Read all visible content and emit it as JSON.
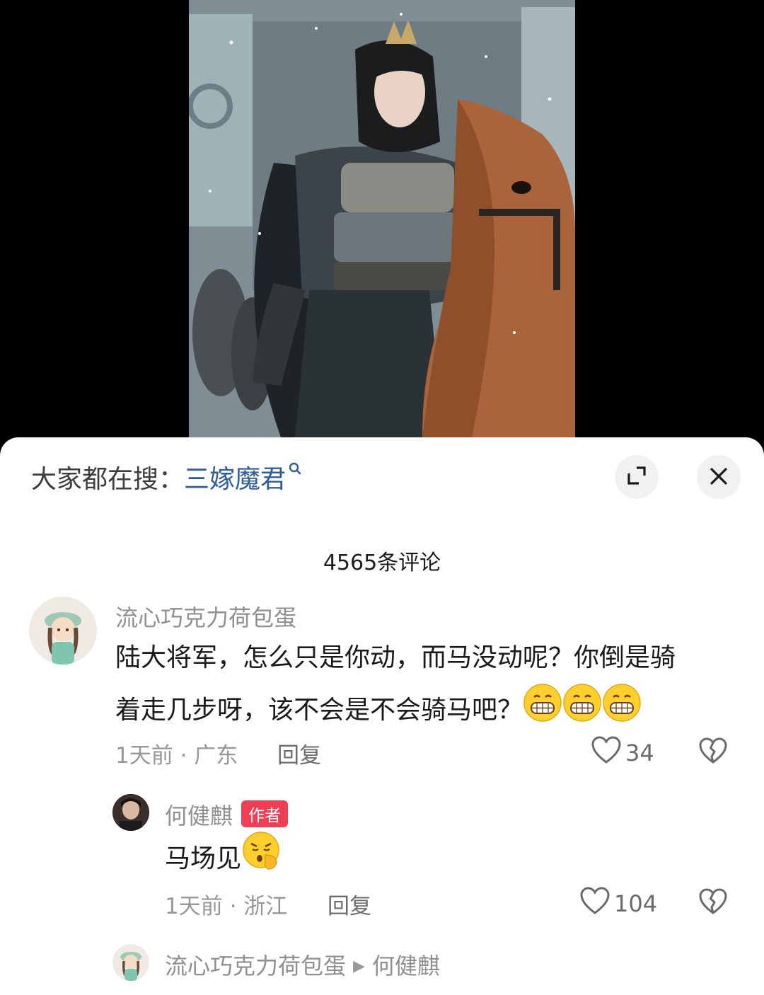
{
  "search": {
    "label": "大家都在搜：",
    "term": "三嫁魔君",
    "icon": "search-icon"
  },
  "header_icons": {
    "expand": "expand-icon",
    "close": "close-icon"
  },
  "comments_count": "4565条评论",
  "comments": [
    {
      "username": "流心巧克力荷包蛋",
      "text_line1": "陆大将军，怎么只是你动，而马没动呢？你倒是骑",
      "text_line2": "着走几步呀，该不会是不会骑马吧？",
      "emojis": [
        "grin-emoji",
        "grin-emoji",
        "grin-emoji"
      ],
      "time": "1天前 · 广东",
      "reply_label": "回复",
      "likes": "34"
    },
    {
      "username": "何健麒",
      "badge": "作者",
      "text": "马场见",
      "emoji": "shush-emoji",
      "time": "1天前 · 浙江",
      "reply_label": "回复",
      "likes": "104"
    },
    {
      "username": "流心巧克力荷包蛋",
      "reply_to": "何健麒"
    }
  ],
  "colors": {
    "link_blue": "#2f5d9a",
    "badge_red": "#f03e54",
    "emoji_yellow": "#ffcf2e"
  }
}
